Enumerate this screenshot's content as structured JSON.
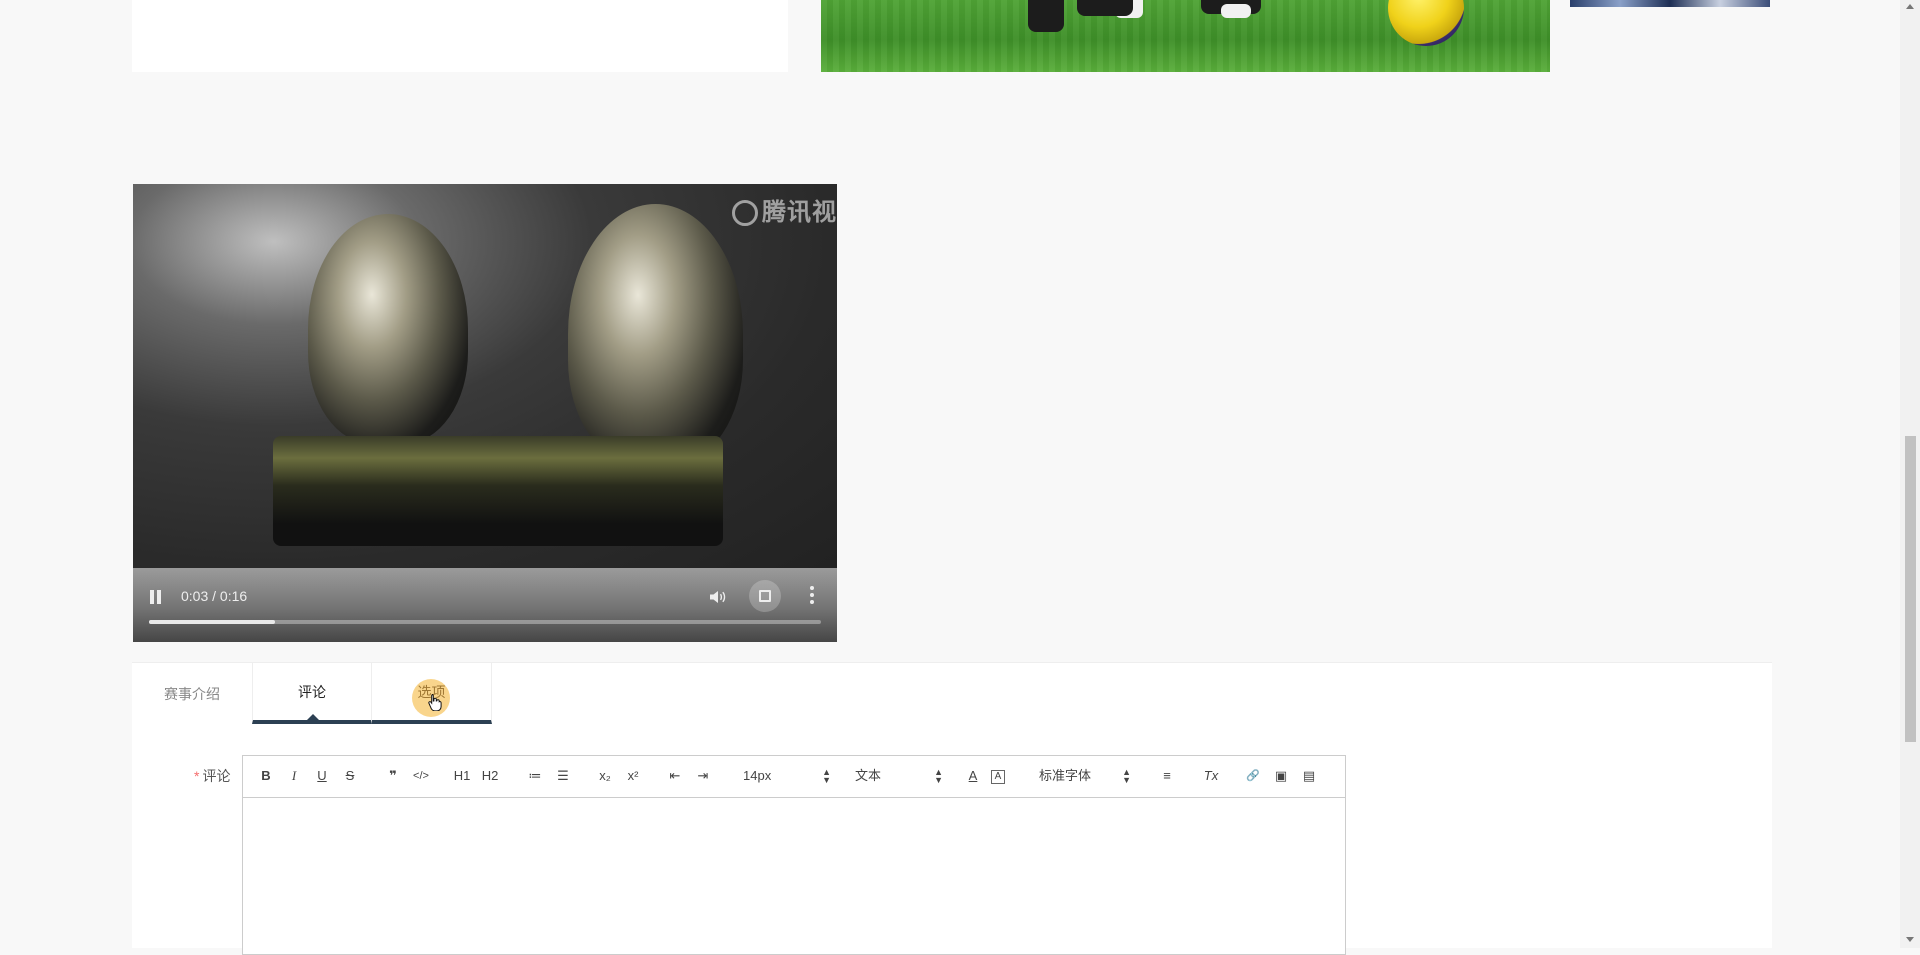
{
  "video": {
    "watermark": "腾讯视",
    "time": "0:03 / 0:16",
    "progress_fraction": 0.1875
  },
  "tabs": [
    {
      "label": "赛事介绍",
      "state": "normal"
    },
    {
      "label": "评论",
      "state": "active"
    },
    {
      "label": "选项",
      "state": "hover"
    }
  ],
  "form": {
    "required_mark": "*",
    "comment_label": "评论"
  },
  "toolbar": {
    "bold": "B",
    "italic": "I",
    "underline": "U",
    "strike": "S",
    "quote": "❞",
    "code": "</>",
    "h1": "H1",
    "h2": "H2",
    "ordered_list": "≔",
    "bullet_list": "☰",
    "subscript": "x₂",
    "superscript": "x²",
    "outdent": "⇤",
    "indent": "⇥",
    "size_select": "14px",
    "header_select": "文本",
    "font_color": "A",
    "background_color": "A",
    "font_select": "标准字体",
    "align": "≡",
    "clean": "Tx",
    "link": "🔗",
    "image": "▣",
    "video": "▤"
  }
}
